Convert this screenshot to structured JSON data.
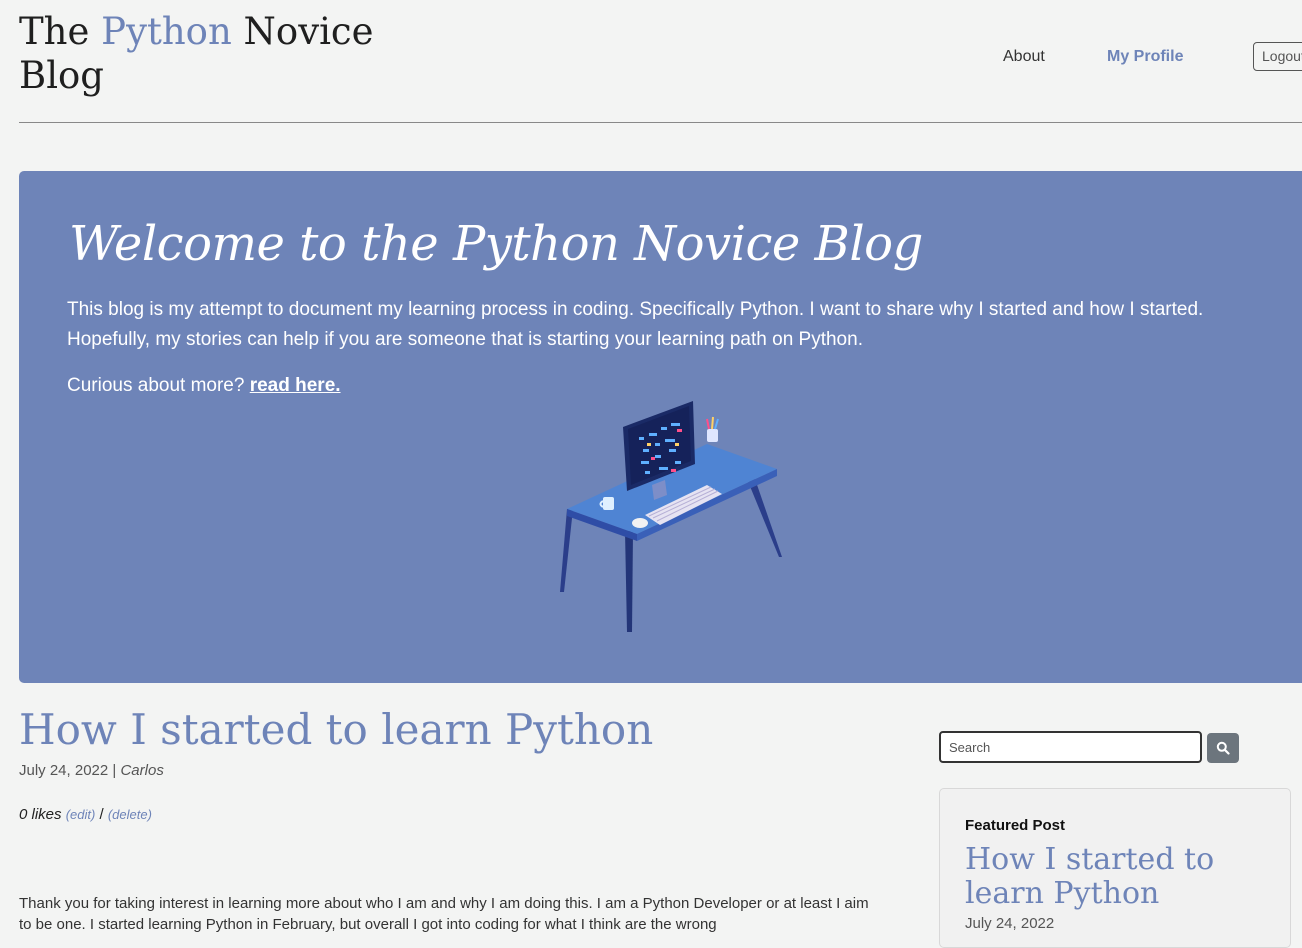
{
  "header": {
    "brand": {
      "part1": "The ",
      "accent": "Python",
      "part2": " Novice",
      "part3": "Blog"
    },
    "nav": {
      "about": "About",
      "profile": "My Profile",
      "logout": "Logout"
    }
  },
  "hero": {
    "title": "Welcome to the Python Novice Blog",
    "text": "This blog is my attempt to document my learning process in coding. Specifically Python. I want to share why I started and how I started. Hopefully, my stories can help if you are someone that is starting your learning path on Python.",
    "more_prefix": "Curious about more? ",
    "more_link": "read here."
  },
  "post": {
    "title": "How I started to learn Python",
    "date": "July 24, 2022",
    "separator": " | ",
    "author": "Carlos",
    "likes": "0 likes",
    "edit": "(edit)",
    "slash": " / ",
    "delete": "(delete)",
    "body": "Thank you for taking interest in learning more about who I am and why I am doing this. I am a Python Developer or at least I aim to be one. I started learning Python in February, but overall I got into coding for what I think are the wrong"
  },
  "sidebar": {
    "search_placeholder": "Search",
    "featured_label": "Featured Post",
    "featured_title": "How I started to learn Python",
    "featured_date": "July 24, 2022"
  },
  "colors": {
    "accent": "#6e84b8",
    "background": "#f3f4f3"
  }
}
